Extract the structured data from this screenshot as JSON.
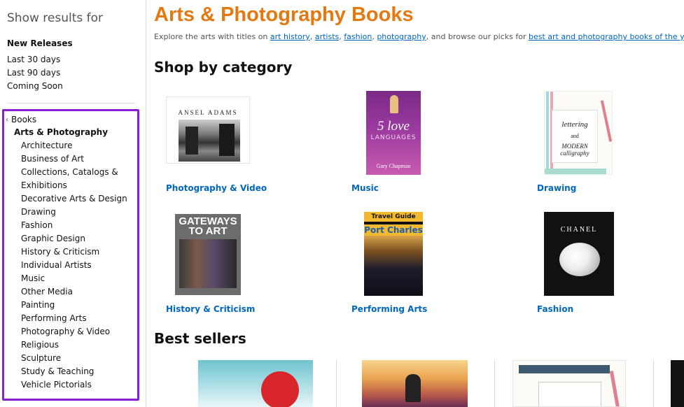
{
  "sidebar": {
    "show_results": "Show results for",
    "new_releases": {
      "title": "New Releases",
      "items": [
        "Last 30 days",
        "Last 90 days",
        "Coming Soon"
      ]
    },
    "back_label": "Books",
    "current_category": "Arts & Photography",
    "subcategories": [
      "Architecture",
      "Business of Art",
      "Collections, Catalogs &",
      "Exhibitions",
      "Decorative Arts & Design",
      "Drawing",
      "Fashion",
      "Graphic Design",
      "History & Criticism",
      "Individual Artists",
      "Music",
      "Other Media",
      "Painting",
      "Performing Arts",
      "Photography & Video",
      "Religious",
      "Sculpture",
      "Study & Teaching",
      "Vehicle Pictorials"
    ],
    "highlight_color": "#8a1fd4"
  },
  "main": {
    "title": "Arts & Photography Books",
    "title_color": "#e47911",
    "intro": {
      "prefix": "Explore the arts with titles on ",
      "link_art_history": "art history",
      "sep1": ", ",
      "link_artists": "artists",
      "sep2": ", ",
      "link_fashion": "fashion",
      "sep3": ", ",
      "link_photography": "photography",
      "middle": ", and browse our picks for ",
      "link_best": "best art and photography books of the year",
      "suffix": "."
    },
    "shop_by_category": "Shop by category",
    "categories": [
      {
        "label": "Photography & Video",
        "cover_text": "ANSEL ADAMS"
      },
      {
        "label": "Music",
        "cover_big": "5 love",
        "cover_lang": "LANGUAGES",
        "cover_author": "Gary Chapman"
      },
      {
        "label": "Drawing",
        "cover_w1": "lettering",
        "cover_w2": "and",
        "cover_w3": "MODERN calligraphy"
      },
      {
        "label": "History & Criticism",
        "cover_text": "GATEWAYS TO ART"
      },
      {
        "label": "Performing Arts",
        "cover_tg": "Travel Guide",
        "cover_pc": "Port Charles"
      },
      {
        "label": "Fashion",
        "cover_text": "CHANEL"
      }
    ],
    "best_sellers": "Best sellers",
    "link_color": "#0066c0"
  }
}
